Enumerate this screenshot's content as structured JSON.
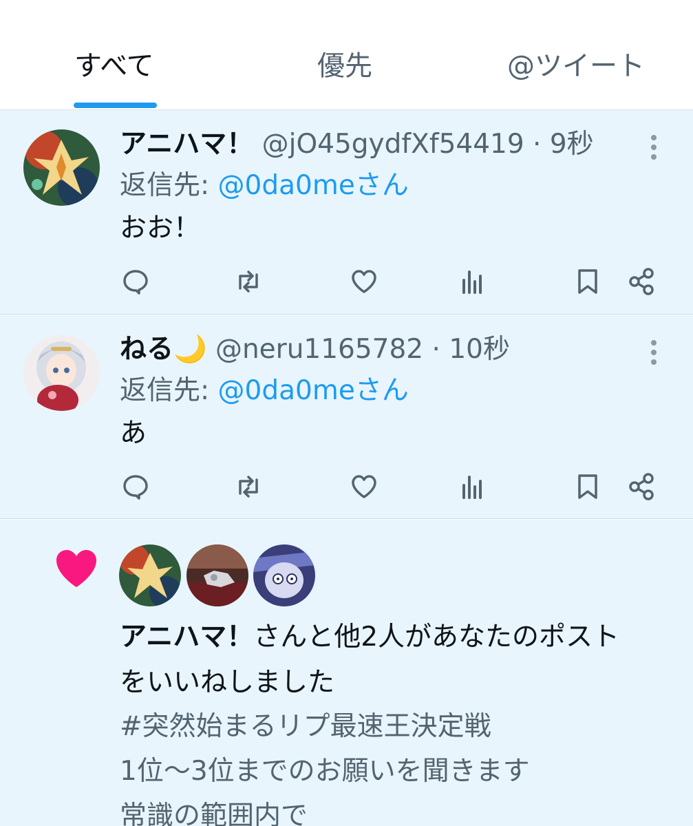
{
  "tabs": {
    "all": "すべて",
    "priority": "優先",
    "mentions": "@ツイート"
  },
  "tweets": [
    {
      "name": "アニハマ！",
      "handle": "@jO45gydfXf54419",
      "separator": "·",
      "time": "9秒",
      "reply_prefix": "返信先:",
      "reply_to": "@0da0meさん",
      "text": "おお！",
      "avatar_icon": "avatar-golden-dragon"
    },
    {
      "name": "ねる🌙",
      "handle": "@neru1165782",
      "separator": "·",
      "time": "10秒",
      "reply_prefix": "返信先:",
      "reply_to": "@0da0meさん",
      "text": "あ",
      "avatar_icon": "avatar-anime-girl"
    }
  ],
  "notification": {
    "icon": "heart-icon",
    "heart_color": "#f91880",
    "who": "アニハマ！",
    "summary_rest": "さんと他2人があなたのポスト",
    "summary_line2": "をいいねしました",
    "post_lines": [
      "#突然始まるリプ最速王決定戦",
      "1位〜3位までのお願いを聞きます",
      "常識の範囲内で"
    ]
  },
  "colors": {
    "accent": "#1d9bf0",
    "highlight_bg": "#e8f5fd",
    "secondary_text": "#536471"
  }
}
